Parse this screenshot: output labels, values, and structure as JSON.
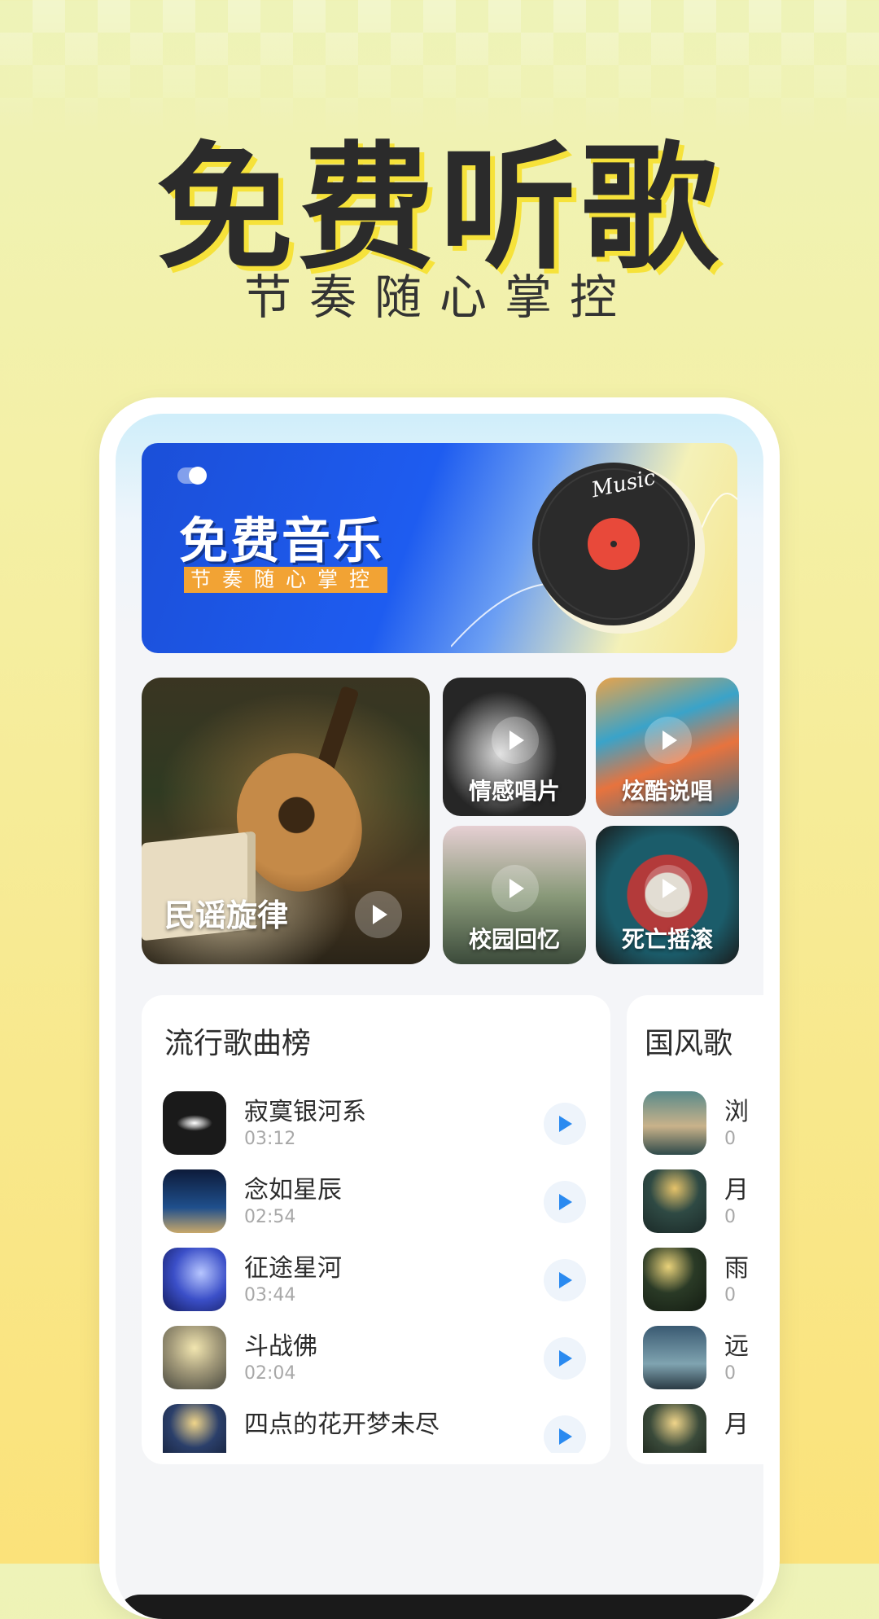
{
  "hero": {
    "title": "免费听歌",
    "subtitle": "节奏随心掌控"
  },
  "banner": {
    "title": "免费音乐",
    "subtitle": "节奏随心掌控",
    "disc_text": "Music",
    "colors": {
      "blue": "#1e5cf0",
      "yellow": "#f6e58e",
      "disc": "#2b2b2b",
      "label": "#e8493a"
    }
  },
  "categories": [
    {
      "label": "民谣旋律"
    },
    {
      "label": "情感唱片"
    },
    {
      "label": "炫酷说唱"
    },
    {
      "label": "校园回忆"
    },
    {
      "label": "死亡摇滚"
    }
  ],
  "charts": [
    {
      "title": "流行歌曲榜",
      "songs": [
        {
          "name": "寂寞银河系",
          "time": "03:12"
        },
        {
          "name": "念如星辰",
          "time": "02:54"
        },
        {
          "name": "征途星河",
          "time": "03:44"
        },
        {
          "name": "斗战佛",
          "time": "02:04"
        },
        {
          "name": "四点的花开梦未尽",
          "time": ""
        }
      ]
    },
    {
      "title": "国风歌",
      "songs": [
        {
          "name": "浏",
          "time": "0"
        },
        {
          "name": "月",
          "time": "0"
        },
        {
          "name": "雨",
          "time": "0"
        },
        {
          "name": "远",
          "time": "0"
        },
        {
          "name": "月",
          "time": ""
        }
      ]
    }
  ]
}
